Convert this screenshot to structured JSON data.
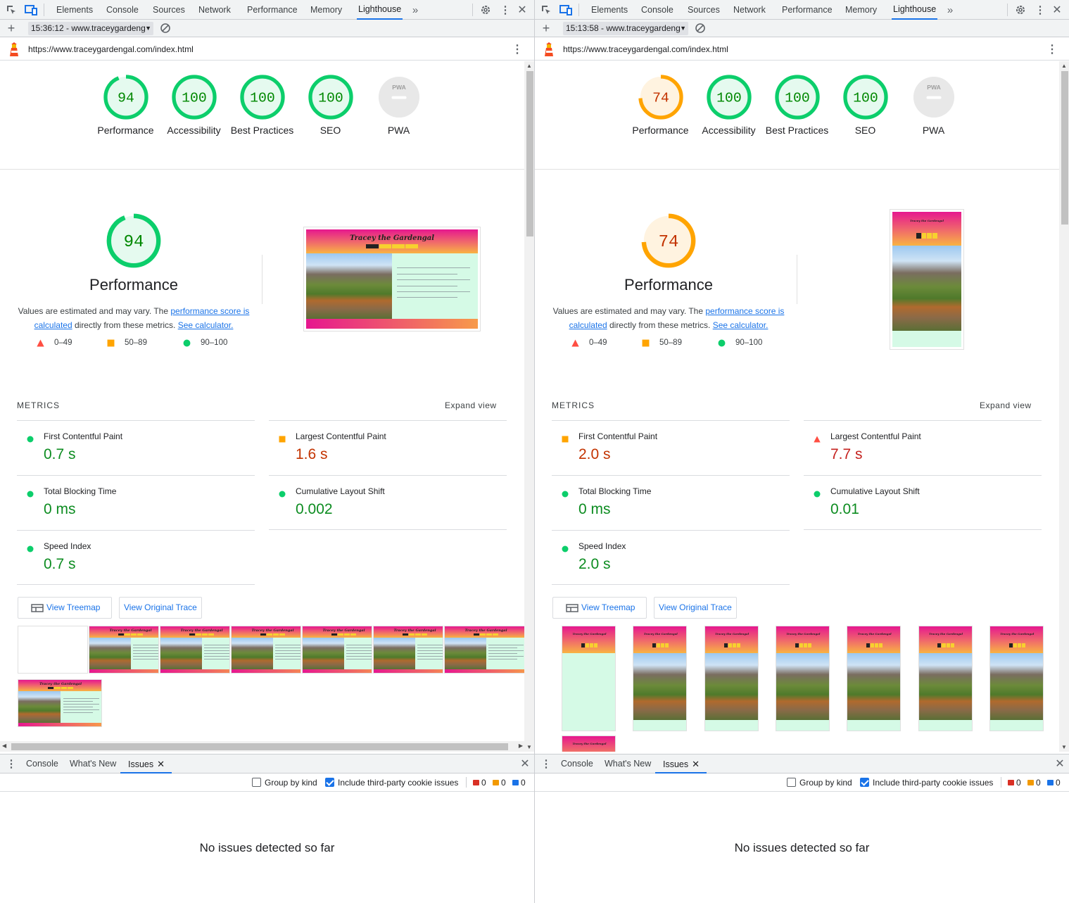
{
  "tabs": [
    "Elements",
    "Console",
    "Sources",
    "Network",
    "Performance",
    "Memory",
    "Lighthouse"
  ],
  "drawer_tabs": [
    "Console",
    "What's New",
    "Issues"
  ],
  "legend": {
    "low": "0–49",
    "mid": "50–89",
    "high": "90–100"
  },
  "perf_title": "Performance",
  "desc": {
    "pre": "Values are estimated and may vary. The ",
    "link1": "performance score is calculated",
    "mid": " directly from these metrics. ",
    "link2": "See calculator."
  },
  "metrics_heading": "METRICS",
  "expand_label": "Expand view",
  "treemap_label": "View Treemap",
  "trace_label": "View Original Trace",
  "group_by_kind": "Group by kind",
  "include_third_party": "Include third-party cookie issues",
  "no_issues": "No issues detected so far",
  "site_title": "Tracey the Gardengal",
  "colors": {
    "green": "#0cce6b",
    "orange": "#ffa400",
    "red": "#ff4e42",
    "accent": "#1a73e8"
  },
  "panes": [
    {
      "timestamp": "15:36:12 - www.traceygardeng",
      "url": "https://www.traceygardengal.com/index.html",
      "scores": [
        {
          "label": "Performance",
          "value": "94",
          "status": "pass"
        },
        {
          "label": "Accessibility",
          "value": "100",
          "status": "pass"
        },
        {
          "label": "Best Practices",
          "value": "100",
          "status": "pass"
        },
        {
          "label": "SEO",
          "value": "100",
          "status": "pass"
        },
        {
          "label": "PWA",
          "value": "—",
          "status": "na"
        }
      ],
      "perf_score": "94",
      "metrics": [
        {
          "name": "First Contentful Paint",
          "value": "0.7 s",
          "status": "pass"
        },
        {
          "name": "Largest Contentful Paint",
          "value": "1.6 s",
          "status": "average"
        },
        {
          "name": "Total Blocking Time",
          "value": "0 ms",
          "status": "pass"
        },
        {
          "name": "Cumulative Layout Shift",
          "value": "0.002",
          "status": "pass"
        },
        {
          "name": "Speed Index",
          "value": "0.7 s",
          "status": "pass"
        }
      ],
      "issue_counts": {
        "errors": "0",
        "warnings": "0",
        "info": "0"
      }
    },
    {
      "timestamp": "15:13:58 - www.traceygardeng",
      "url": "https://www.traceygardengal.com/index.html",
      "scores": [
        {
          "label": "Performance",
          "value": "74",
          "status": "average"
        },
        {
          "label": "Accessibility",
          "value": "100",
          "status": "pass"
        },
        {
          "label": "Best Practices",
          "value": "100",
          "status": "pass"
        },
        {
          "label": "SEO",
          "value": "100",
          "status": "pass"
        },
        {
          "label": "PWA",
          "value": "—",
          "status": "na"
        }
      ],
      "perf_score": "74",
      "metrics": [
        {
          "name": "First Contentful Paint",
          "value": "2.0 s",
          "status": "average"
        },
        {
          "name": "Largest Contentful Paint",
          "value": "7.7 s",
          "status": "fail"
        },
        {
          "name": "Total Blocking Time",
          "value": "0 ms",
          "status": "pass"
        },
        {
          "name": "Cumulative Layout Shift",
          "value": "0.01",
          "status": "pass"
        },
        {
          "name": "Speed Index",
          "value": "2.0 s",
          "status": "pass"
        }
      ],
      "issue_counts": {
        "errors": "0",
        "warnings": "0",
        "info": "0"
      }
    }
  ]
}
